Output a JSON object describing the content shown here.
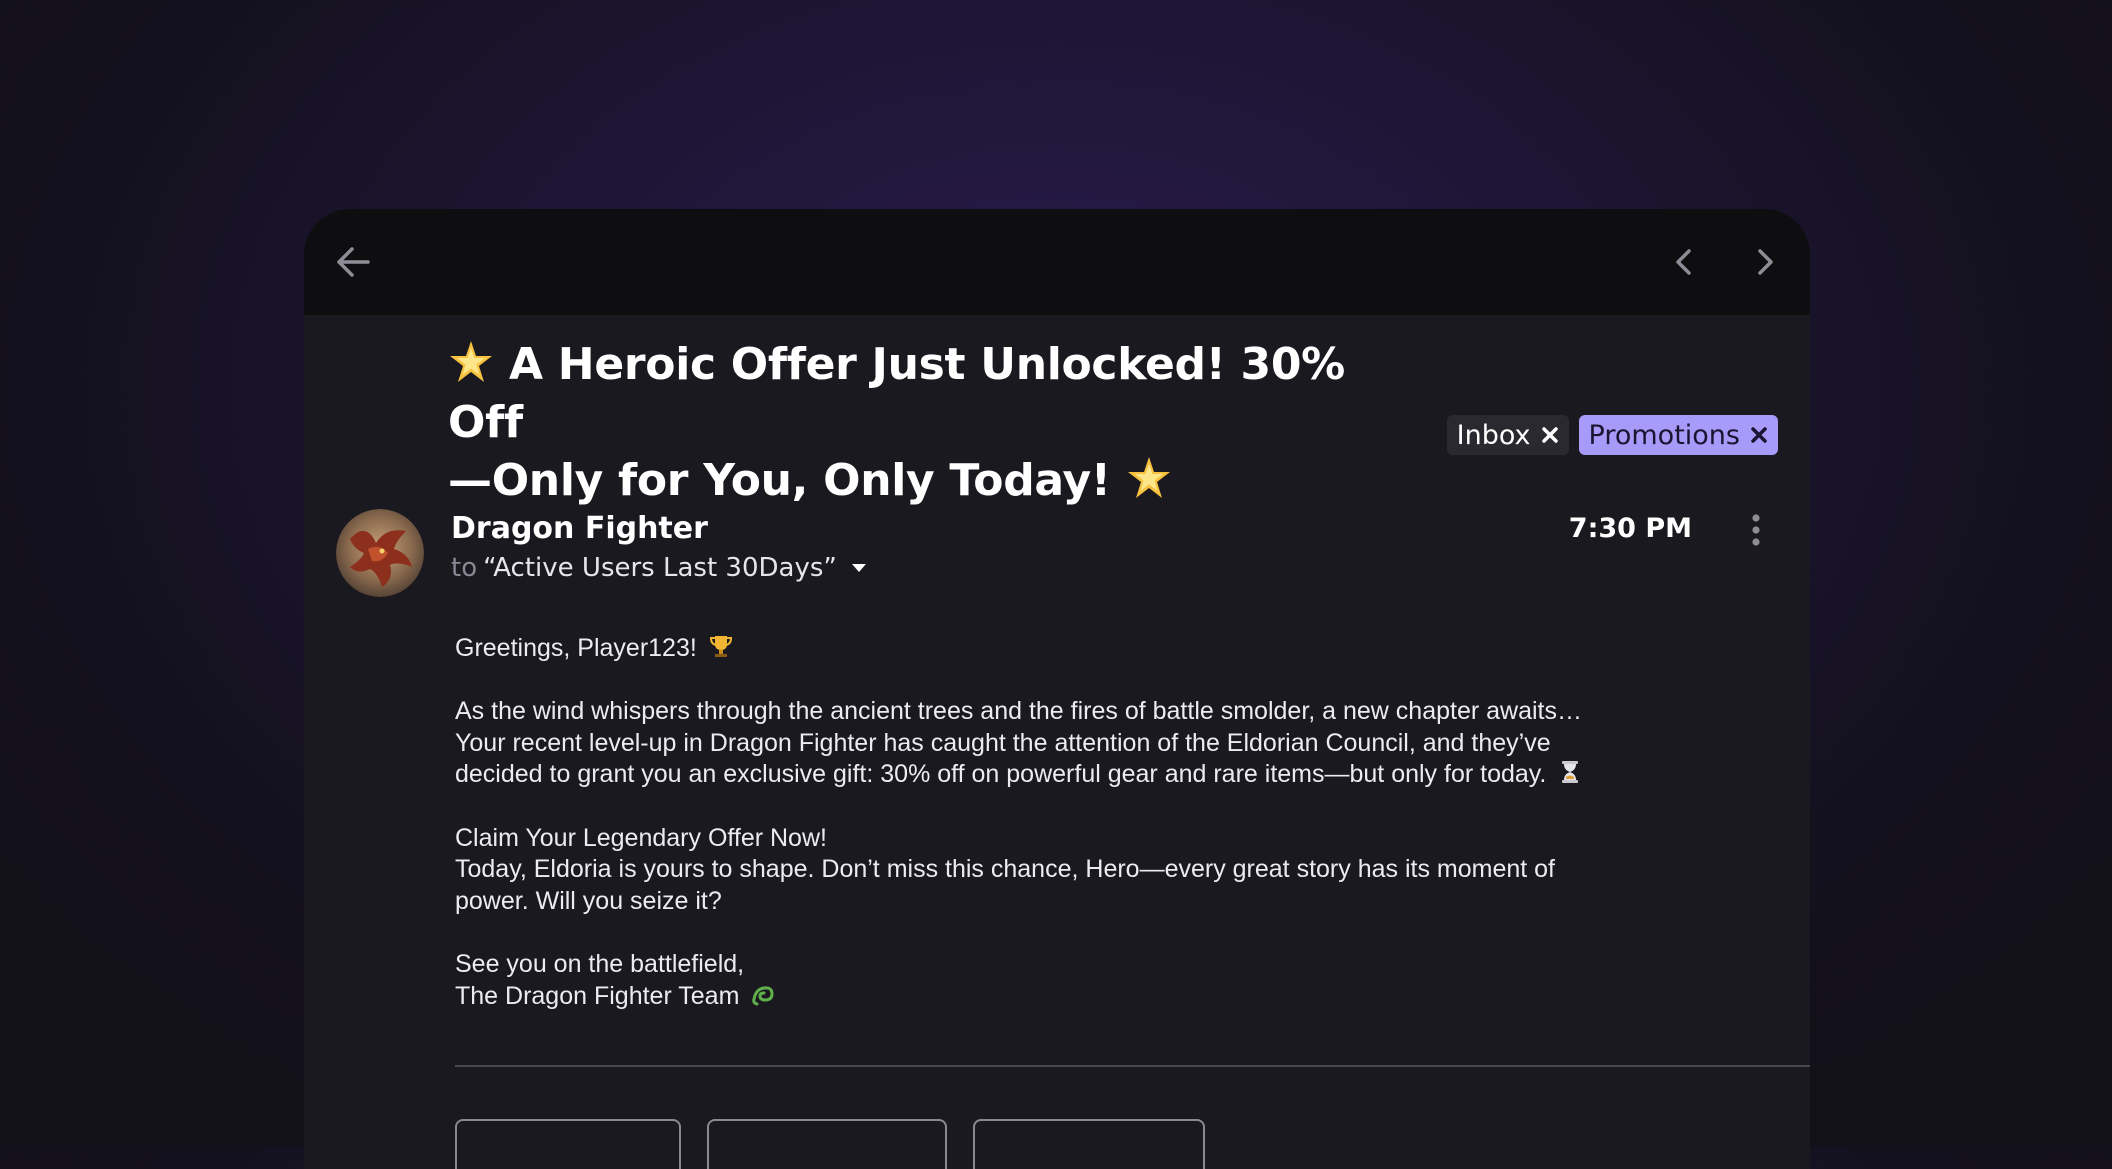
{
  "subject": {
    "line1": "A Heroic Offer Just Unlocked! 30% Off",
    "line2": "—Only for You, Only Today!",
    "icons": [
      "star-emoji",
      "star-emoji"
    ]
  },
  "labels": [
    {
      "name": "Inbox",
      "bg": "#2a2930"
    },
    {
      "name": "Promotions",
      "bg": "#a79af8"
    }
  ],
  "sender": {
    "name": "Dragon Fighter",
    "to_prefix": "to",
    "recipient": "“Active Users Last 30Days”"
  },
  "time": "7:30 PM",
  "body": {
    "greeting": "Greetings, Player123!",
    "para1_line1": "As the wind whispers through the ancient trees and the fires of battle smolder, a new chapter awaits…",
    "para1_line2": "Your recent level-up in Dragon Fighter has caught the attention of the Eldorian Council, and they’ve",
    "para1_line3": "decided to grant you an exclusive gift: 30% off on powerful gear and rare items—but only for today.",
    "para2_title": "Claim Your Legendary Offer Now!",
    "para2_line1": "Today, Eldoria is yours to shape. Don’t miss this chance, Hero—every great story has its moment of",
    "para2_line2": "power. Will you seize it?",
    "signoff": "See you on the battlefield,",
    "signature": "The Dragon Fighter Team"
  },
  "icons": {
    "back": "back-arrow-icon",
    "prev": "chevron-left-icon",
    "next": "chevron-right-icon",
    "more": "more-vertical-icon",
    "greeting": "trophy-emoji",
    "para1": "hourglass-emoji",
    "signature": "dragon-emoji"
  },
  "colors": {
    "accent": "#a79af8",
    "window_bg": "#1a191f",
    "topbar_bg": "#0e0e10"
  }
}
